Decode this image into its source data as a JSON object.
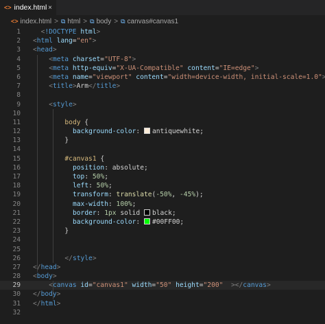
{
  "tab": {
    "filename": "index.html",
    "icon": "html5-icon",
    "close": "×"
  },
  "breadcrumb": {
    "file": "index.html",
    "html": "html",
    "body": "body",
    "canvas": "canvas#canvas1",
    "sep": ">"
  },
  "colors": {
    "antiquewhite": "#faebd7",
    "black": "#000000",
    "green": "#00ff00"
  },
  "current_line": 29,
  "lines": [
    {
      "n": "1",
      "indent": 1,
      "tokens": [
        [
          "p",
          "<"
        ],
        [
          "t",
          "!DOCTYPE"
        ],
        [
          "x",
          " "
        ],
        [
          "a",
          "html"
        ],
        [
          "p",
          ">"
        ]
      ]
    },
    {
      "n": "2",
      "indent": 0,
      "tokens": [
        [
          "p",
          "<"
        ],
        [
          "t",
          "html"
        ],
        [
          "x",
          " "
        ],
        [
          "a",
          "lang"
        ],
        [
          "x",
          "="
        ],
        [
          "s",
          "\"en\""
        ],
        [
          "p",
          ">"
        ]
      ]
    },
    {
      "n": "3",
      "indent": 0,
      "tokens": [
        [
          "p",
          "<"
        ],
        [
          "t",
          "head"
        ],
        [
          "p",
          ">"
        ]
      ]
    },
    {
      "n": "4",
      "indent": 2,
      "tokens": [
        [
          "p",
          "<"
        ],
        [
          "t",
          "meta"
        ],
        [
          "x",
          " "
        ],
        [
          "a",
          "charset"
        ],
        [
          "x",
          "="
        ],
        [
          "s",
          "\"UTF-8\""
        ],
        [
          "p",
          ">"
        ]
      ]
    },
    {
      "n": "5",
      "indent": 2,
      "tokens": [
        [
          "p",
          "<"
        ],
        [
          "t",
          "meta"
        ],
        [
          "x",
          " "
        ],
        [
          "a",
          "http-equiv"
        ],
        [
          "x",
          "="
        ],
        [
          "s",
          "\"X-UA-Compatible\""
        ],
        [
          "x",
          " "
        ],
        [
          "a",
          "content"
        ],
        [
          "x",
          "="
        ],
        [
          "s",
          "\"IE=edge\""
        ],
        [
          "p",
          ">"
        ]
      ]
    },
    {
      "n": "6",
      "indent": 2,
      "tokens": [
        [
          "p",
          "<"
        ],
        [
          "t",
          "meta"
        ],
        [
          "x",
          " "
        ],
        [
          "a",
          "name"
        ],
        [
          "x",
          "="
        ],
        [
          "s",
          "\"viewport\""
        ],
        [
          "x",
          " "
        ],
        [
          "a",
          "content"
        ],
        [
          "x",
          "="
        ],
        [
          "s",
          "\"width=device-width, initial-scale=1.0\""
        ],
        [
          "p",
          ">"
        ]
      ]
    },
    {
      "n": "7",
      "indent": 2,
      "tokens": [
        [
          "p",
          "<"
        ],
        [
          "t",
          "title"
        ],
        [
          "p",
          ">"
        ],
        [
          "x",
          "Arm"
        ],
        [
          "p",
          "</"
        ],
        [
          "t",
          "title"
        ],
        [
          "p",
          ">"
        ]
      ]
    },
    {
      "n": "8",
      "indent": 0,
      "tokens": []
    },
    {
      "n": "9",
      "indent": 2,
      "tokens": [
        [
          "p",
          "<"
        ],
        [
          "t",
          "style"
        ],
        [
          "p",
          ">"
        ]
      ]
    },
    {
      "n": "10",
      "indent": 0,
      "tokens": []
    },
    {
      "n": "11",
      "indent": 4,
      "tokens": [
        [
          "sel",
          "body"
        ],
        [
          "x",
          " {"
        ]
      ]
    },
    {
      "n": "12",
      "indent": 5,
      "tokens": [
        [
          "pr",
          "background-color"
        ],
        [
          "x",
          ": "
        ],
        [
          "sw",
          "antiquewhite"
        ],
        [
          "x",
          "antiquewhite;"
        ]
      ]
    },
    {
      "n": "13",
      "indent": 4,
      "tokens": [
        [
          "x",
          "}"
        ]
      ]
    },
    {
      "n": "14",
      "indent": 0,
      "tokens": []
    },
    {
      "n": "15",
      "indent": 4,
      "tokens": [
        [
          "sel",
          "#canvas1"
        ],
        [
          "x",
          " {"
        ]
      ]
    },
    {
      "n": "16",
      "indent": 5,
      "tokens": [
        [
          "pr",
          "position"
        ],
        [
          "x",
          ": absolute;"
        ]
      ]
    },
    {
      "n": "17",
      "indent": 5,
      "tokens": [
        [
          "pr",
          "top"
        ],
        [
          "x",
          ": "
        ],
        [
          "num",
          "50%"
        ],
        [
          "x",
          ";"
        ]
      ]
    },
    {
      "n": "18",
      "indent": 5,
      "tokens": [
        [
          "pr",
          "left"
        ],
        [
          "x",
          ": "
        ],
        [
          "num",
          "50%"
        ],
        [
          "x",
          ";"
        ]
      ]
    },
    {
      "n": "19",
      "indent": 5,
      "tokens": [
        [
          "pr",
          "transform"
        ],
        [
          "x",
          ": "
        ],
        [
          "fn",
          "translate"
        ],
        [
          "x",
          "("
        ],
        [
          "num",
          "-50%"
        ],
        [
          "x",
          ", "
        ],
        [
          "num",
          "-45%"
        ],
        [
          "x",
          ");"
        ]
      ]
    },
    {
      "n": "20",
      "indent": 5,
      "tokens": [
        [
          "pr",
          "max-width"
        ],
        [
          "x",
          ": "
        ],
        [
          "num",
          "100%"
        ],
        [
          "x",
          ";"
        ]
      ]
    },
    {
      "n": "21",
      "indent": 5,
      "tokens": [
        [
          "pr",
          "border"
        ],
        [
          "x",
          ": "
        ],
        [
          "num",
          "1px"
        ],
        [
          "x",
          " solid "
        ],
        [
          "sw",
          "black"
        ],
        [
          "x",
          "black;"
        ]
      ]
    },
    {
      "n": "22",
      "indent": 5,
      "tokens": [
        [
          "pr",
          "background-color"
        ],
        [
          "x",
          ": "
        ],
        [
          "sw",
          "green"
        ],
        [
          "x",
          "#00FF00;"
        ]
      ]
    },
    {
      "n": "23",
      "indent": 4,
      "tokens": [
        [
          "x",
          "}"
        ]
      ]
    },
    {
      "n": "24",
      "indent": 0,
      "tokens": []
    },
    {
      "n": "25",
      "indent": 0,
      "tokens": []
    },
    {
      "n": "26",
      "indent": 4,
      "tokens": [
        [
          "p",
          "</"
        ],
        [
          "t",
          "style"
        ],
        [
          "p",
          ">"
        ]
      ]
    },
    {
      "n": "27",
      "indent": 0,
      "tokens": [
        [
          "p",
          "</"
        ],
        [
          "t",
          "head"
        ],
        [
          "p",
          ">"
        ]
      ]
    },
    {
      "n": "28",
      "indent": 0,
      "tokens": [
        [
          "p",
          "<"
        ],
        [
          "t",
          "body"
        ],
        [
          "p",
          ">"
        ]
      ]
    },
    {
      "n": "29",
      "indent": 2,
      "tokens": [
        [
          "p",
          "<"
        ],
        [
          "t",
          "canvas"
        ],
        [
          "x",
          " "
        ],
        [
          "a",
          "id"
        ],
        [
          "x",
          "="
        ],
        [
          "s",
          "\"canvas1\""
        ],
        [
          "x",
          " "
        ],
        [
          "a",
          "width"
        ],
        [
          "x",
          "="
        ],
        [
          "s",
          "\"50\""
        ],
        [
          "x",
          " "
        ],
        [
          "a",
          "height"
        ],
        [
          "x",
          "="
        ],
        [
          "s",
          "\"200\""
        ],
        [
          "x",
          "  "
        ],
        [
          "p",
          "></"
        ],
        [
          "t",
          "canvas"
        ],
        [
          "p",
          ">"
        ]
      ]
    },
    {
      "n": "30",
      "indent": 0,
      "tokens": [
        [
          "p",
          "</"
        ],
        [
          "t",
          "body"
        ],
        [
          "p",
          ">"
        ]
      ]
    },
    {
      "n": "31",
      "indent": 0,
      "tokens": [
        [
          "p",
          "</"
        ],
        [
          "t",
          "html"
        ],
        [
          "p",
          ">"
        ]
      ]
    },
    {
      "n": "32",
      "indent": 0,
      "tokens": []
    }
  ]
}
